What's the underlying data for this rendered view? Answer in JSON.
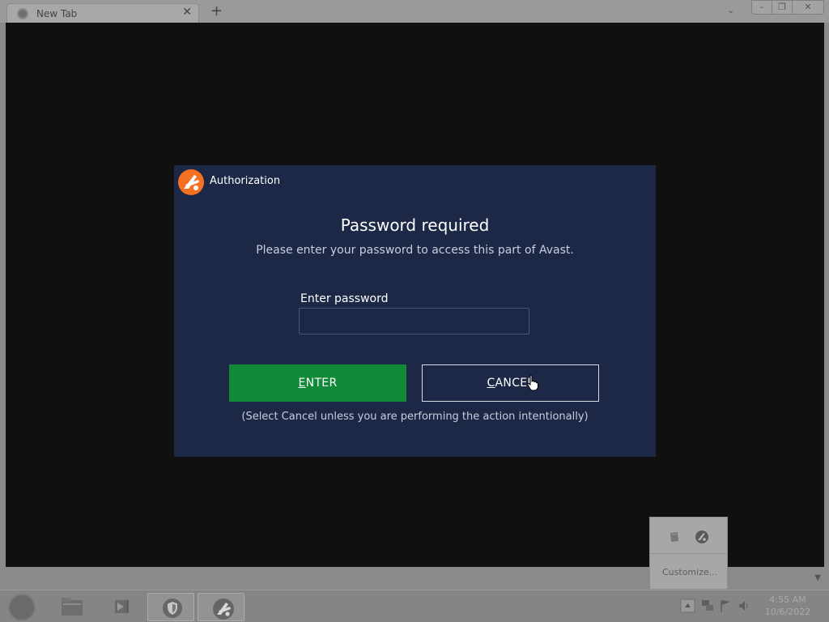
{
  "browser": {
    "tab_title": "New Tab",
    "tab_close": "✕",
    "new_tab": "+",
    "tab_menu": "⌄",
    "win_min": "–",
    "win_max": "❐",
    "win_close": "✕"
  },
  "dialog": {
    "caption": "Authorization",
    "heading": "Password required",
    "subtitle": "Please enter your password to access this part of Avast.",
    "password_label": "Enter password",
    "password_value": "",
    "enter_button": {
      "mnemonic": "E",
      "rest": "NTER"
    },
    "cancel_button": {
      "mnemonic": "C",
      "rest": "ANCEL"
    },
    "note": "(Select Cancel unless you are performing the action intentionally)",
    "colors": {
      "background": "#1c2846",
      "enter": "#0f8a38",
      "logo": "#f37121"
    }
  },
  "tray_popup": {
    "customize_label": "Customize..."
  },
  "taskbar": {
    "clock_time": "4:55 AM",
    "clock_date": "10/6/2022"
  },
  "icons": [
    "chrome-icon",
    "file-explorer-icon",
    "media-player-icon",
    "shield-icon",
    "avast-icon",
    "network-icon",
    "flag-icon",
    "volume-icon",
    "mouse-cursor-icon"
  ]
}
